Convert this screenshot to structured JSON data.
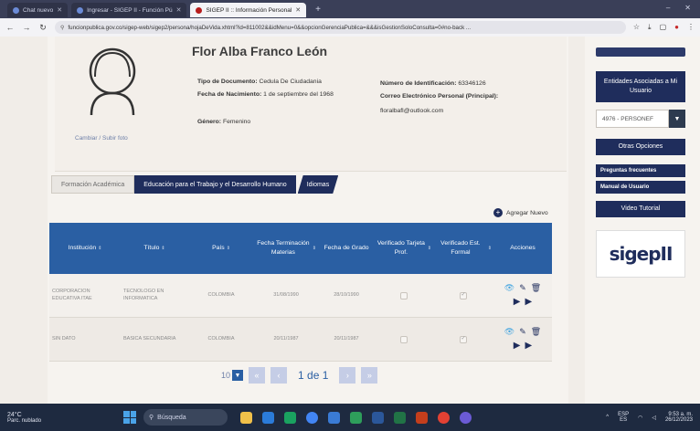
{
  "browser": {
    "tabs": [
      {
        "label": "Chat nuevo",
        "active": false
      },
      {
        "label": "Ingresar - SIGEP II - Función Pú",
        "active": false
      },
      {
        "label": "SIGEP II :: Información Personal",
        "active": true
      }
    ],
    "url": "funcionpublica.gov.co/sigep-web/sigep2/persona/hojaDeVida.xhtml?id=811002&&idMenu=0&&opcionGerenciaPublica=&&&isGestionSoloConsulta=0#no-back ..."
  },
  "profile": {
    "name": "Flor Alba Franco León",
    "doc_type_label": "Tipo de Documento:",
    "doc_type_value": "Cedula De Ciudadania",
    "birth_label": "Fecha de Nacimiento:",
    "birth_value": "1 de septiembre del 1968",
    "gender_label": "Género:",
    "gender_value": "Femenino",
    "id_label": "Número de Identificación:",
    "id_value": "63346126",
    "email_label": "Correo Electrónico Personal (Principal):",
    "email_value": "floralbafl@outlook.com",
    "change_photo": "Cambiar / Subir foto"
  },
  "section_tabs": [
    "Formación Académica",
    "Educación para el Trabajo y el Desarrollo Humano",
    "Idiomas"
  ],
  "add_new": "Agregar Nuevo",
  "table": {
    "headers": [
      "Institución",
      "Título",
      "País",
      "Fecha Terminación Materias",
      "Fecha de Grado",
      "Verificado Tarjeta Prof.",
      "Verificado Est. Formal",
      "Acciones"
    ],
    "rows": [
      [
        "CORPORACION EDUCATIVA ITAE",
        "TECNOLOGO EN INFORMATICA",
        "COLOMBIA",
        "31/08/1990",
        "28/10/1990"
      ],
      [
        "SIN DATO",
        "BASICA SECUNDARIA",
        "COLOMBIA",
        "20/11/1987",
        "20/11/1987"
      ]
    ]
  },
  "pager": {
    "page_size": "10",
    "page_text": "1 de 1"
  },
  "sidebar": {
    "entities": "Entidades Asociadas a Mi Usuario",
    "select_value": "4976 - PERSONEF",
    "other_options": "Otras Opciones",
    "faq": "Preguntas frecuentes",
    "manual": "Manual de Usuario",
    "video": "Video Tutorial",
    "logo_text": "sigepII"
  },
  "taskbar": {
    "temp": "24°C",
    "weather": "Parc. nublado",
    "search": "Búsqueda",
    "lang_top": "ESP",
    "lang_bottom": "ES",
    "time": "9:53 a. m.",
    "date": "26/12/2023"
  },
  "colors": {
    "navy": "#1f2d5c",
    "table_header": "#2a5fa3",
    "eye_icon": "#49a7e0"
  }
}
